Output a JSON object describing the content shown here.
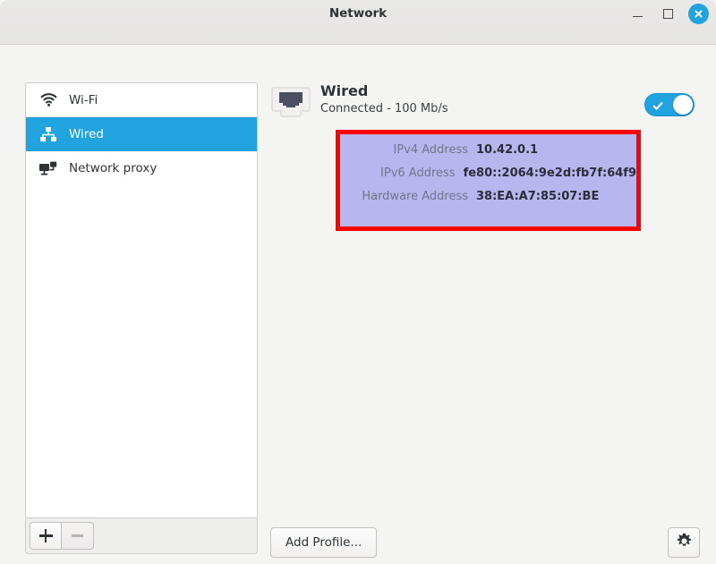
{
  "window": {
    "title": "Network",
    "controls": {
      "minimize": "minimize",
      "maximize": "maximize",
      "close": "close"
    }
  },
  "sidebar": {
    "items": [
      {
        "label": "Wi-Fi",
        "icon": "wifi-icon",
        "selected": false
      },
      {
        "label": "Wired",
        "icon": "wired-network-icon",
        "selected": true
      },
      {
        "label": "Network proxy",
        "icon": "network-proxy-icon",
        "selected": false
      }
    ],
    "toolbar": {
      "add_label": "+",
      "remove_label": "−"
    }
  },
  "main": {
    "device": {
      "name": "Wired",
      "status": "Connected - 100 Mb/s",
      "icon": "ethernet-port-icon",
      "toggle_state": "on"
    },
    "details": [
      {
        "label": "IPv4 Address",
        "value": "10.42.0.1"
      },
      {
        "label": "IPv6 Address",
        "value": "fe80::2064:9e2d:fb7f:64f9"
      },
      {
        "label": "Hardware Address",
        "value": "38:EA:A7:85:07:BE"
      }
    ],
    "add_profile_label": "Add Profile...",
    "settings_icon": "gear-icon"
  },
  "colors": {
    "accent": "#21a3e0",
    "highlight_border": "#ff0000",
    "highlight_fill": "#b7b6ef",
    "window_bg": "#f4f4f3",
    "panel_bg": "#ffffff"
  }
}
